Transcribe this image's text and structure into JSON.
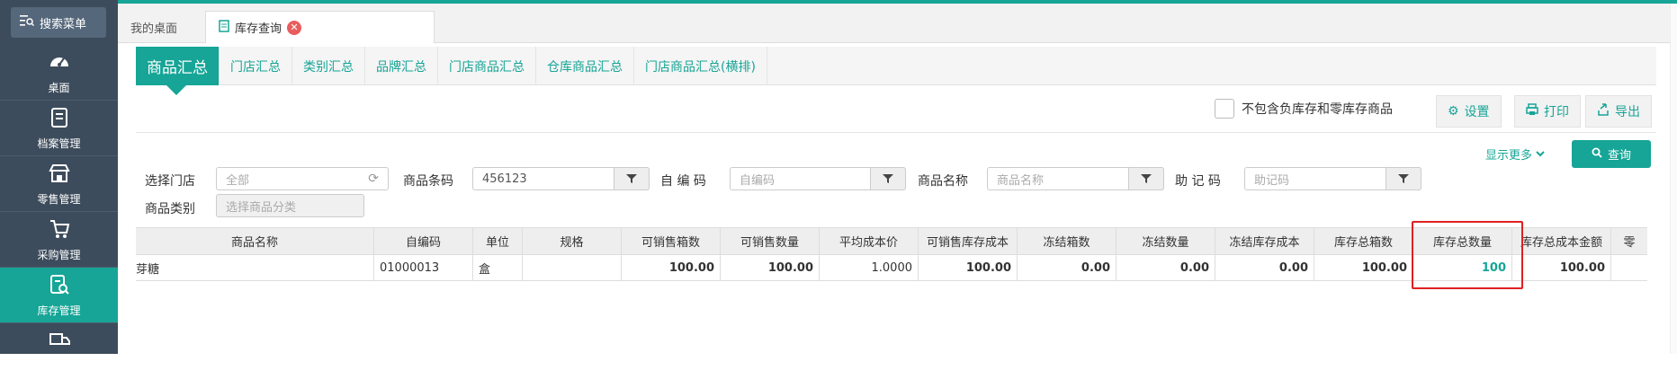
{
  "sidebar": {
    "search_label": "搜索菜单",
    "items": [
      {
        "label": "桌面",
        "icon": "dashboard-icon"
      },
      {
        "label": "档案管理",
        "icon": "archive-icon"
      },
      {
        "label": "零售管理",
        "icon": "store-icon"
      },
      {
        "label": "采购管理",
        "icon": "cart-icon"
      },
      {
        "label": "库存管理",
        "icon": "inventory-icon",
        "active": true
      },
      {
        "label": "",
        "icon": "truck-icon"
      }
    ]
  },
  "tabs": [
    {
      "label": "我的桌面"
    },
    {
      "label": "库存查询",
      "active": true
    }
  ],
  "subtabs": [
    "商品汇总",
    "门店汇总",
    "类别汇总",
    "品牌汇总",
    "门店商品汇总",
    "仓库商品汇总",
    "门店商品汇总(横排)"
  ],
  "actions": {
    "checkbox_label": "不包含负库存和零库存商品",
    "settings": "设置",
    "print": "打印",
    "export": "导出",
    "show_more": "显示更多",
    "query": "查询"
  },
  "filters": {
    "store_label": "选择门店",
    "store_placeholder": "全部",
    "barcode_label": "商品条码",
    "barcode_value": "456123",
    "selfcode_label": "自 编 码",
    "selfcode_placeholder": "自编码",
    "name_label": "商品名称",
    "name_placeholder": "商品名称",
    "mnemonic_label": "助 记 码",
    "mnemonic_placeholder": "助记码",
    "category_label": "商品类别",
    "category_placeholder": "选择商品分类"
  },
  "table": {
    "headers": [
      "商品名称",
      "自编码",
      "单位",
      "规格",
      "可销售箱数",
      "可销售数量",
      "平均成本价",
      "可销售库存成本",
      "冻结箱数",
      "冻结数量",
      "冻结库存成本",
      "库存总箱数",
      "库存总数量",
      "库存总成本金额",
      "零"
    ],
    "rows": [
      [
        "芽糖",
        "01000013",
        "盒",
        "",
        "100.00",
        "100.00",
        "1.0000",
        "100.00",
        "0.00",
        "0.00",
        "0.00",
        "100.00",
        "100",
        "100.00",
        ""
      ]
    ]
  },
  "colors": {
    "accent": "#16a596",
    "sidebar": "#3d4c5c",
    "highlight_box": "#e02020"
  }
}
